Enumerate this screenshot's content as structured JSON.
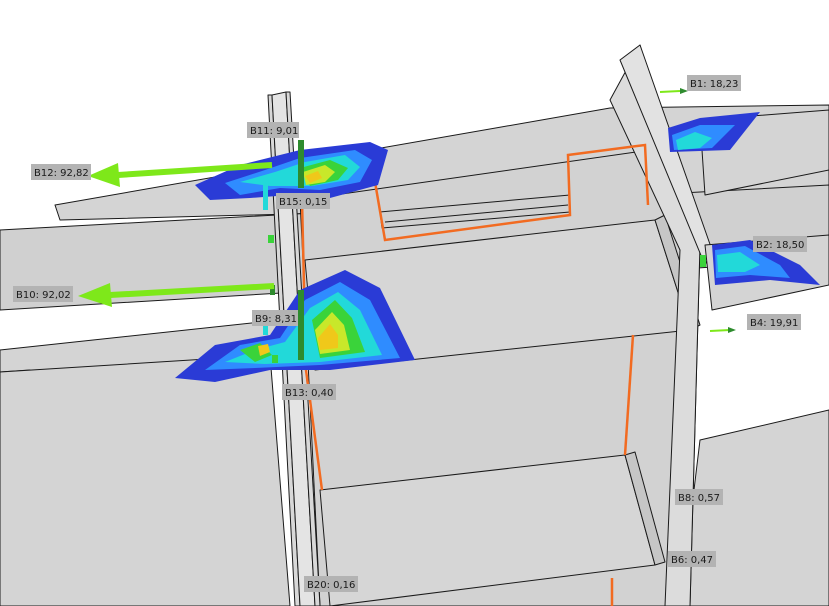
{
  "scene": {
    "description_free": true,
    "plate_color": "#d4d4d4",
    "edge_color": "#1a1a1a",
    "weld_line_color": "#f26b21",
    "force_arrow_color": "#7ee81a",
    "stress_colors": [
      "#2a3bd6",
      "#2f8cff",
      "#22d9d9",
      "#3ad33a",
      "#c8e82a",
      "#f0c81a"
    ]
  },
  "bolt_labels": [
    {
      "id": "B1",
      "text": "B1: 18,23"
    },
    {
      "id": "B2",
      "text": "B2: 18,50"
    },
    {
      "id": "B4",
      "text": "B4: 19,91"
    },
    {
      "id": "B6",
      "text": "B6: 0,47"
    },
    {
      "id": "B8",
      "text": "B8: 0,57"
    },
    {
      "id": "B9",
      "text": "B9: 8,31"
    },
    {
      "id": "B10",
      "text": "B10: 92,02"
    },
    {
      "id": "B11",
      "text": "B11: 9,01"
    },
    {
      "id": "B12",
      "text": "B12: 92,82"
    },
    {
      "id": "B13",
      "text": "B13: 0,40"
    },
    {
      "id": "B15",
      "text": "B15: 0,15"
    },
    {
      "id": "B20",
      "text": "B20: 0,16"
    }
  ]
}
